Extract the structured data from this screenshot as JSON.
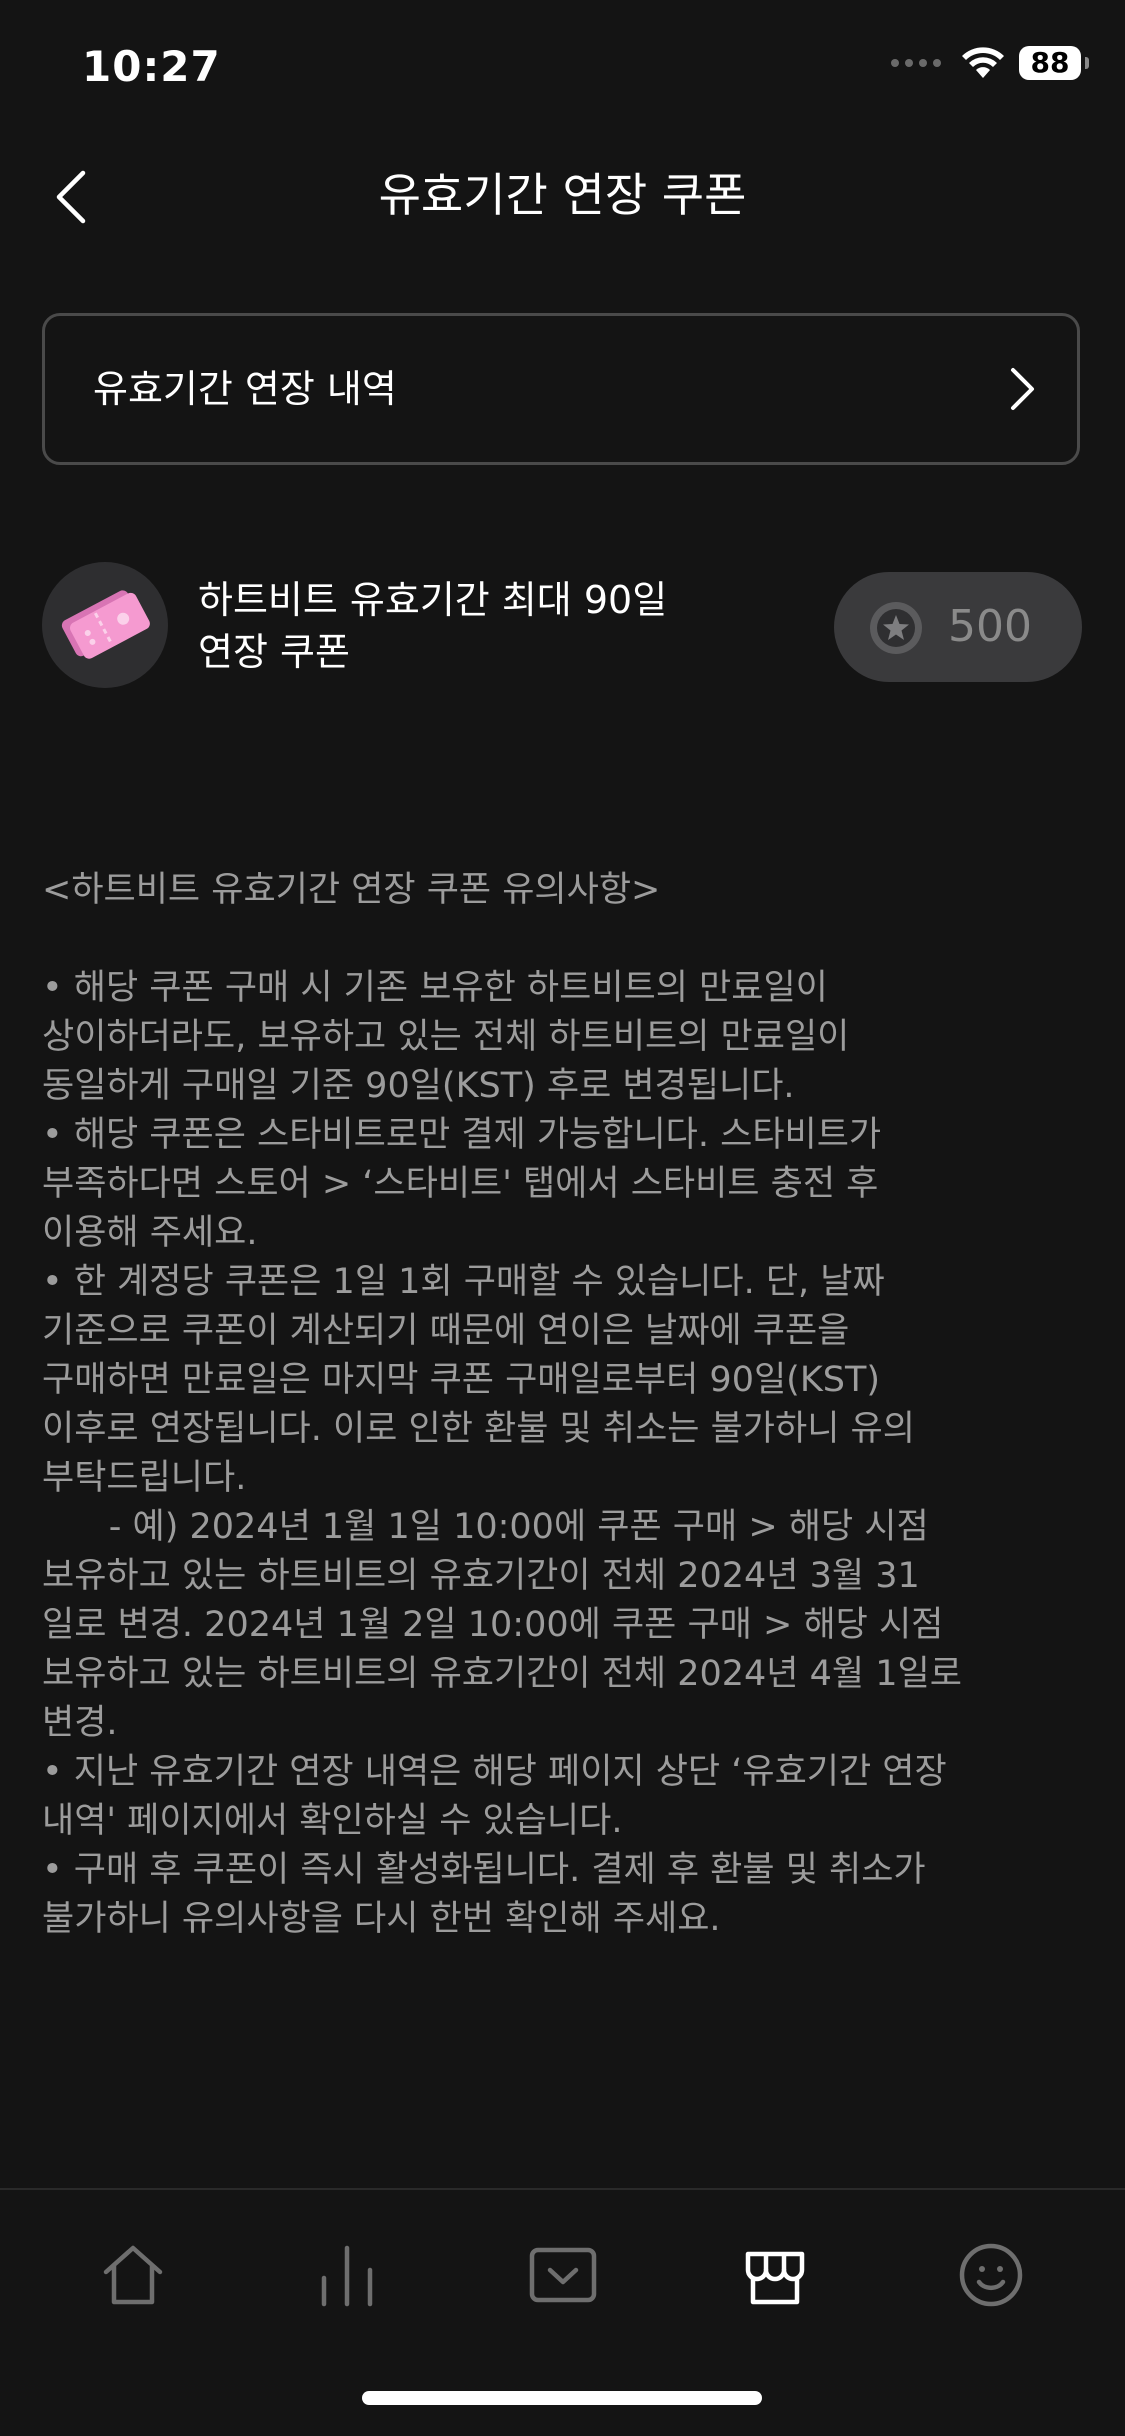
{
  "status_bar": {
    "time": "10:27",
    "battery": "88",
    "icons": [
      "cellular-signal-icon",
      "wifi-icon",
      "battery-icon"
    ]
  },
  "header": {
    "title": "유효기간 연장 쿠폰",
    "back_icon": "chevron-left-icon"
  },
  "history_link": {
    "label": "유효기간 연장 내역",
    "icon": "chevron-right-icon"
  },
  "product": {
    "name_line1": "하트비트 유효기간 최대 90일",
    "name_line2": "연장 쿠폰",
    "thumb_icon": "coupon-ticket-icon",
    "price": "500",
    "price_icon": "star-coin-icon",
    "ticket_color": "#f59ad0"
  },
  "notice": {
    "title": "<하트비트 유효기간 연장 쿠폰 유의사항>",
    "lines": [
      "• 해당 쿠폰 구매 시 기존 보유한 하트비트의 만료일이",
      "상이하더라도, 보유하고 있는 전체 하트비트의 만료일이",
      "동일하게 구매일 기준 90일(KST) 후로 변경됩니다.",
      "• 해당 쿠폰은 스타비트로만 결제 가능합니다. 스타비트가",
      "부족하다면 스토어 > ‘스타비트' 탭에서 스타비트 충전 후",
      "이용해 주세요.",
      "• 한 계정당 쿠폰은 1일 1회 구매할 수 있습니다. 단, 날짜",
      "기준으로 쿠폰이 계산되기 때문에 연이은 날짜에 쿠폰을",
      "구매하면 만료일은 마지막 쿠폰 구매일로부터 90일(KST)",
      "이후로 연장됩니다. 이로 인한 환불 및 취소는 불가하니 유의",
      "부탁드립니다.",
      "      - 예) 2024년 1월 1일 10:00에 쿠폰 구매 > 해당 시점",
      "보유하고 있는 하트비트의 유효기간이 전체 2024년 3월 31",
      "일로 변경. 2024년 1월 2일 10:00에 쿠폰 구매 > 해당 시점",
      "보유하고 있는 하트비트의 유효기간이 전체 2024년 4월 1일로",
      "변경.",
      "• 지난 유효기간 연장 내역은 해당 페이지 상단 ‘유효기간 연장",
      "내역' 페이지에서 확인하실 수 있습니다.",
      "• 구매 후 쿠폰이 즉시 활성화됩니다. 결제 후 환불 및 취소가",
      "불가하니 유의사항을 다시 한번 확인해 주세요."
    ]
  },
  "tab_bar": {
    "tabs": [
      {
        "icon": "home-icon",
        "active": false
      },
      {
        "icon": "chart-icon",
        "active": false
      },
      {
        "icon": "inbox-check-icon",
        "active": false
      },
      {
        "icon": "store-icon",
        "active": true
      },
      {
        "icon": "smiley-icon",
        "active": false
      }
    ],
    "active_color": "#ffffff",
    "inactive_color": "#6e6e6e"
  }
}
